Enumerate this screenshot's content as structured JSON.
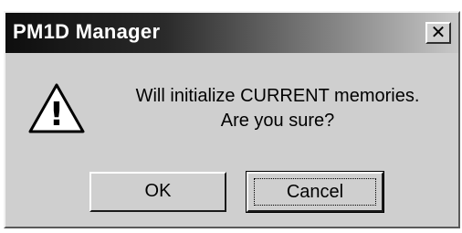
{
  "window": {
    "title": "PM1D Manager",
    "close_glyph": "✕"
  },
  "icon": {
    "name": "warning-icon",
    "glyph": "!"
  },
  "message": {
    "line1": "Will initialize CURRENT memories.",
    "line2": "Are you sure?"
  },
  "buttons": {
    "ok_label": "OK",
    "cancel_label": "Cancel"
  }
}
